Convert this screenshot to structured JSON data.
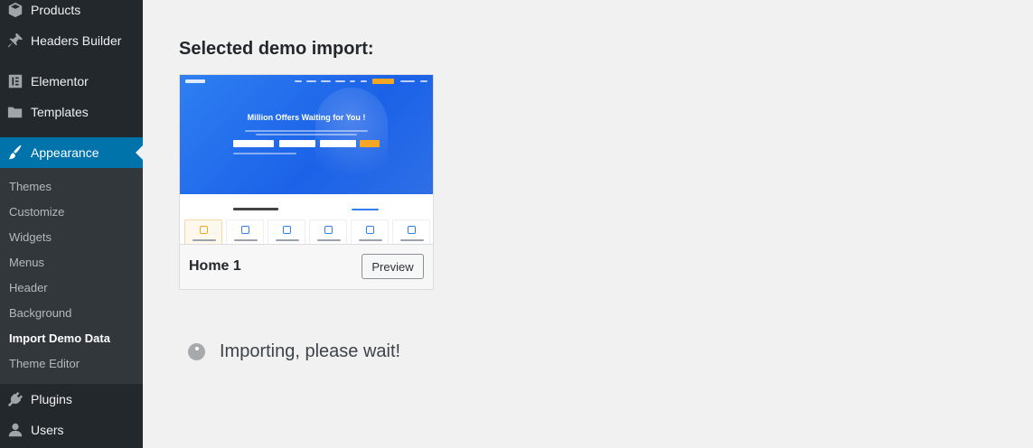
{
  "sidebar": {
    "items": [
      {
        "label": "Products",
        "icon": "products-icon"
      },
      {
        "label": "Headers Builder",
        "icon": "pin-icon"
      },
      {
        "label": "Elementor",
        "icon": "elementor-icon"
      },
      {
        "label": "Templates",
        "icon": "folder-icon"
      },
      {
        "label": "Appearance",
        "icon": "paintbrush-icon",
        "active": true
      },
      {
        "label": "Plugins",
        "icon": "plug-icon"
      },
      {
        "label": "Users",
        "icon": "user-icon"
      }
    ],
    "submenu": [
      {
        "label": "Themes"
      },
      {
        "label": "Customize"
      },
      {
        "label": "Widgets"
      },
      {
        "label": "Menus"
      },
      {
        "label": "Header"
      },
      {
        "label": "Background"
      },
      {
        "label": "Import Demo Data",
        "current": true
      },
      {
        "label": "Theme Editor"
      }
    ],
    "active_color": "#0073aa"
  },
  "main": {
    "title": "Selected demo import:",
    "demo": {
      "thumbnail_headline": "Million Offers Waiting for You !",
      "name": "Home 1",
      "preview_label": "Preview"
    },
    "status_text": "Importing, please wait!"
  },
  "colors": {
    "sidebar_bg": "#23282d",
    "submenu_bg": "#32373c",
    "accent": "#0073aa",
    "page_bg": "#f1f1f1"
  }
}
